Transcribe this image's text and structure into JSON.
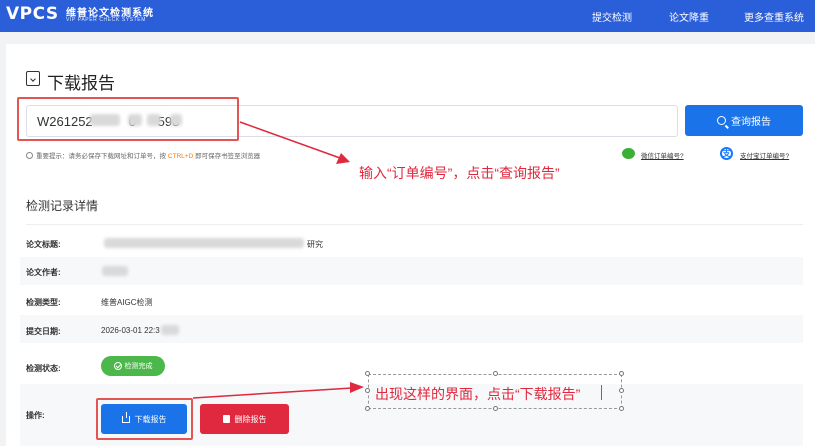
{
  "header": {
    "logo_text": "VPCS",
    "logo_cn": "维普论文检测系统",
    "logo_en": "VIP PAPER CHECK SYSTEM",
    "nav": [
      "提交检测",
      "论文降重",
      "更多查重系统"
    ]
  },
  "page": {
    "title": "下载报告",
    "title_icon": "download-file-icon"
  },
  "search": {
    "value": "W261252          0      598",
    "button_label": "查询报告",
    "button_icon": "search-icon",
    "tip_prefix": "重要提示：请务必保存下载网址和订单号，按",
    "tip_shortcut": "CTRL+D",
    "tip_suffix": "即可保存书签至浏览器",
    "wechat_link": "微信订单编号?",
    "alipay_link": "支付宝订单编号?"
  },
  "details": {
    "section_title": "检测记录详情",
    "rows": [
      {
        "label": "论文标题:",
        "value": "研究"
      },
      {
        "label": "论文作者:",
        "value": ""
      },
      {
        "label": "检测类型:",
        "value": "维普AIGC检测"
      },
      {
        "label": "提交日期:",
        "value": "2026-03-01 22:3"
      },
      {
        "label": "检测状态:",
        "value": ""
      },
      {
        "label": "操作:",
        "value": ""
      }
    ],
    "status_badge": "检测完成",
    "download_label": "下载报告",
    "delete_label": "删除报告"
  },
  "annotations": {
    "step1": "输入“订单编号”，点击“查询报告”",
    "step2": "出现这样的界面，点击“下载报告”",
    "color": "#e0283e"
  },
  "colors": {
    "header": "#2b5fd9",
    "primary": "#1a73e8",
    "danger": "#e0283e",
    "success": "#4cb84c"
  }
}
